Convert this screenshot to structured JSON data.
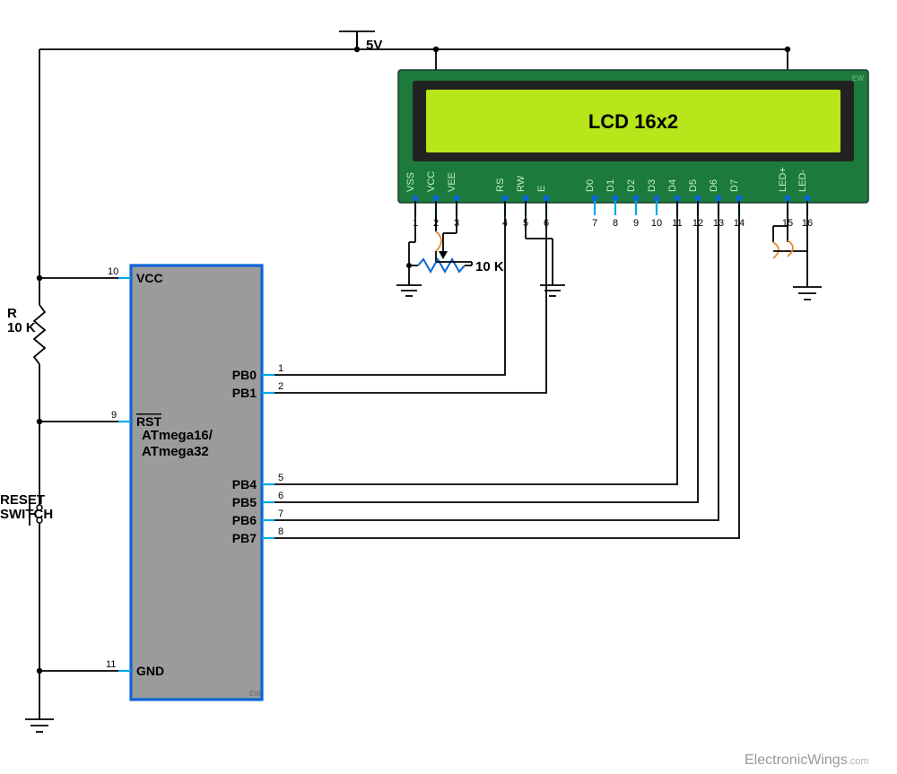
{
  "power_label": "5V",
  "mcu": {
    "label_line1": "ATmega16/",
    "label_line2": "ATmega32",
    "pins": {
      "vcc": {
        "name": "VCC",
        "num": "10"
      },
      "rst": {
        "name": "RST",
        "num": "9"
      },
      "gnd": {
        "name": "GND",
        "num": "11"
      },
      "pb0": {
        "name": "PB0",
        "num": "1"
      },
      "pb1": {
        "name": "PB1",
        "num": "2"
      },
      "pb4": {
        "name": "PB4",
        "num": "5"
      },
      "pb5": {
        "name": "PB5",
        "num": "6"
      },
      "pb6": {
        "name": "PB6",
        "num": "7"
      },
      "pb7": {
        "name": "PB7",
        "num": "8"
      }
    }
  },
  "resistor": {
    "ref": "R",
    "value": "10 K"
  },
  "pot": {
    "value": "10 K"
  },
  "reset_switch": "RESET\nSWITCH",
  "lcd": {
    "title": "LCD 16x2",
    "pins": [
      {
        "n": "1",
        "l": "VSS"
      },
      {
        "n": "2",
        "l": "VCC"
      },
      {
        "n": "3",
        "l": "VEE"
      },
      {
        "n": "4",
        "l": "RS"
      },
      {
        "n": "5",
        "l": "RW"
      },
      {
        "n": "6",
        "l": "E"
      },
      {
        "n": "7",
        "l": "D0"
      },
      {
        "n": "8",
        "l": "D1"
      },
      {
        "n": "9",
        "l": "D2"
      },
      {
        "n": "10",
        "l": "D3"
      },
      {
        "n": "11",
        "l": "D4"
      },
      {
        "n": "12",
        "l": "D5"
      },
      {
        "n": "13",
        "l": "D6"
      },
      {
        "n": "14",
        "l": "D7"
      },
      {
        "n": "15",
        "l": "LED+"
      },
      {
        "n": "16",
        "l": "LED-"
      }
    ]
  },
  "connections": [
    {
      "from": "MCU.PB0",
      "to": "LCD.RS"
    },
    {
      "from": "MCU.PB1",
      "to": "LCD.E"
    },
    {
      "from": "MCU.PB4",
      "to": "LCD.D4"
    },
    {
      "from": "MCU.PB5",
      "to": "LCD.D5"
    },
    {
      "from": "MCU.PB6",
      "to": "LCD.D6"
    },
    {
      "from": "MCU.PB7",
      "to": "LCD.D7"
    },
    {
      "from": "5V",
      "to": "LCD.VCC"
    },
    {
      "from": "5V",
      "to": "MCU.VCC (via 10K to RST)"
    },
    {
      "from": "5V",
      "to": "LCD.LED+"
    },
    {
      "from": "GND",
      "to": "LCD.VSS"
    },
    {
      "from": "GND",
      "to": "LCD.RW"
    },
    {
      "from": "GND",
      "to": "LCD.LED-"
    },
    {
      "from": "POT 10K wiper",
      "to": "LCD.VEE"
    }
  ],
  "credit": "ElectronicWings",
  "credit_suffix": ".com"
}
